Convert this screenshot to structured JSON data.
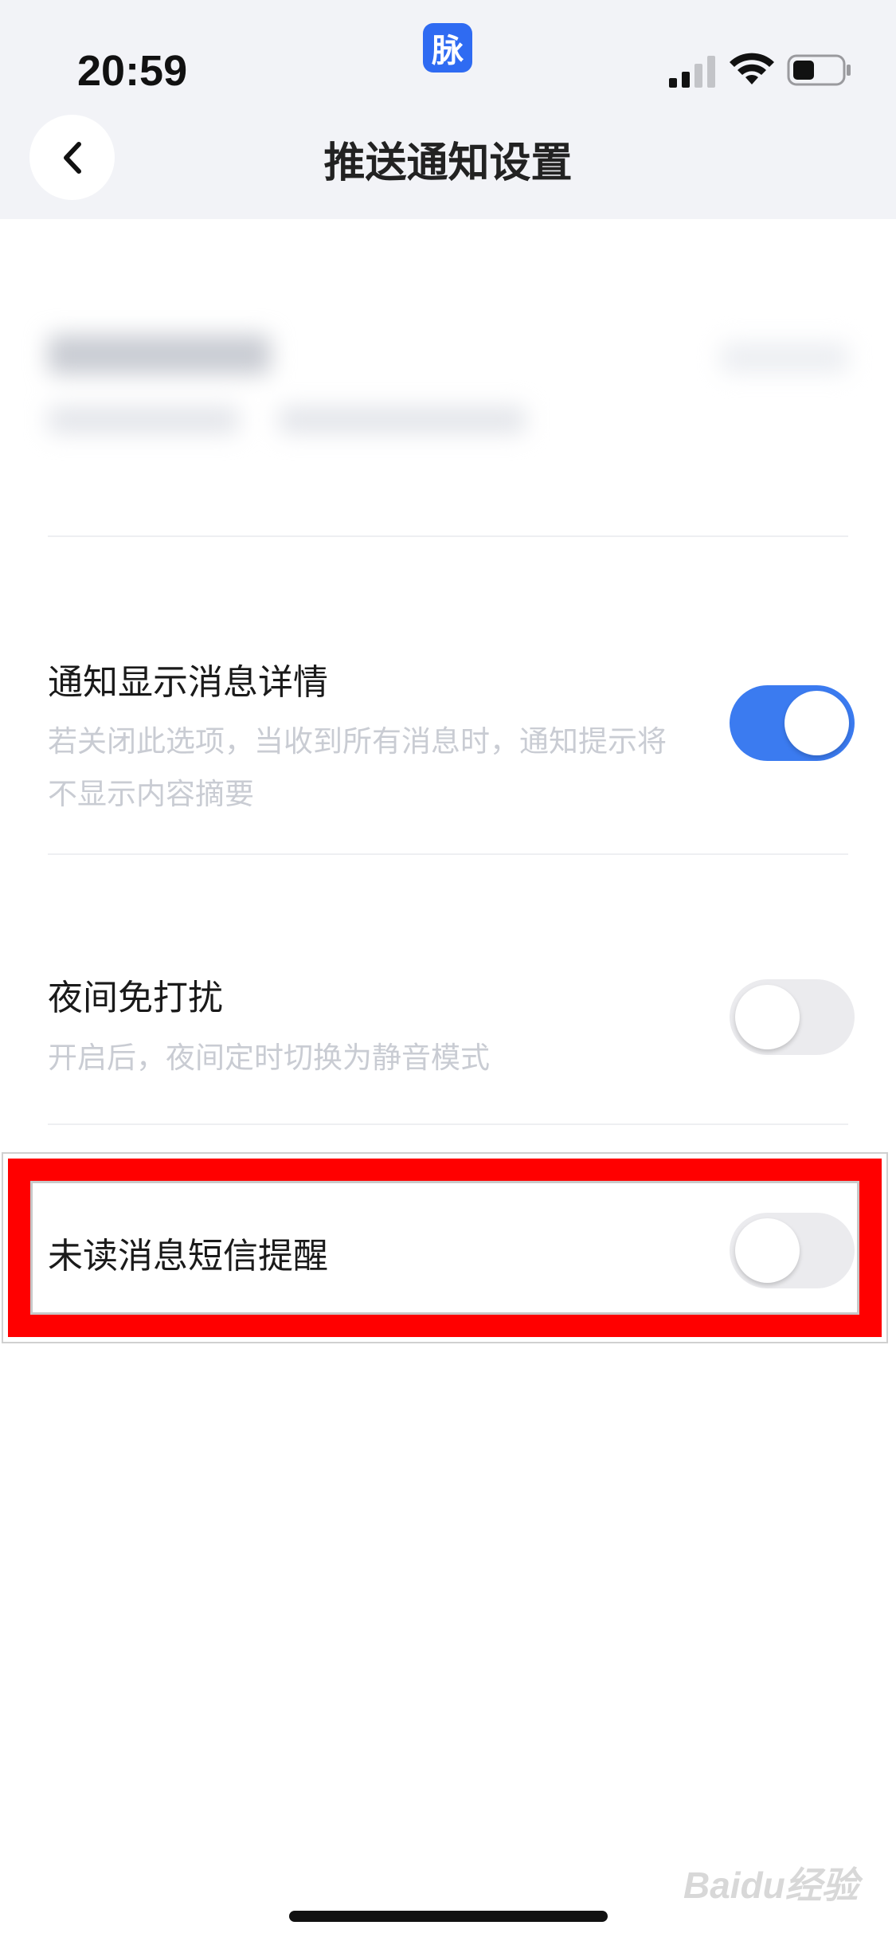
{
  "status_bar": {
    "time": "20:59",
    "app_badge": "脉"
  },
  "header": {
    "title": "推送通知设置",
    "back_icon": "chevron-left-icon"
  },
  "settings": [
    {
      "title": "通知显示消息详情",
      "description": "若关闭此选项，当收到所有消息时，通知提示将不显示内容摘要",
      "enabled": true
    },
    {
      "title": "夜间免打扰",
      "description": "开启后，夜间定时切换为静音模式",
      "enabled": false
    },
    {
      "title": "未读消息短信提醒",
      "description": "",
      "enabled": false,
      "highlighted": true
    }
  ],
  "colors": {
    "toggle_on": "#3b7bf0",
    "toggle_off": "#ebebee",
    "highlight": "#ff0000",
    "app_badge": "#2f6bf2"
  },
  "watermark": "Baidu经验"
}
